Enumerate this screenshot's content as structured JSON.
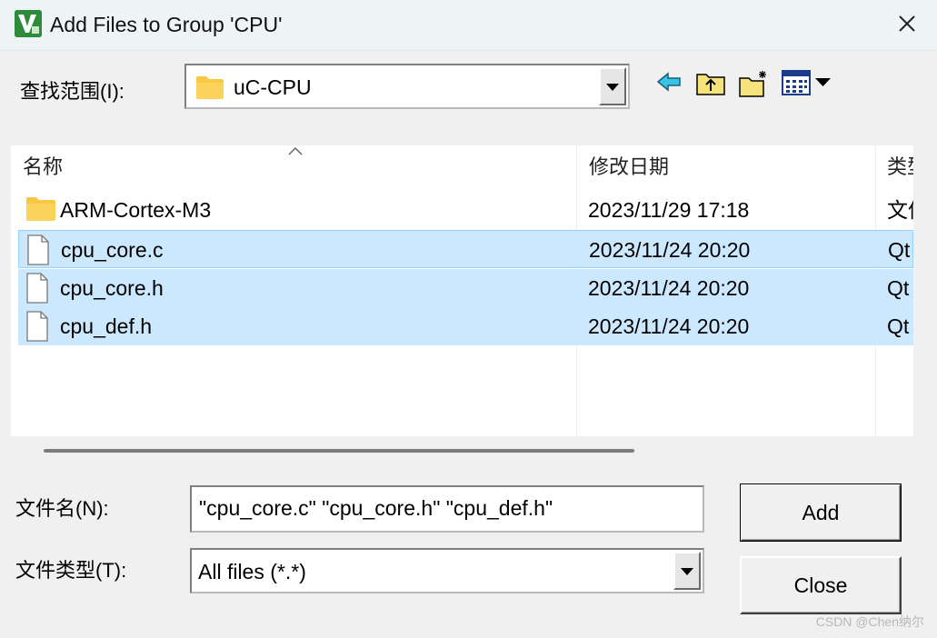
{
  "window": {
    "title": "Add Files to Group 'CPU'",
    "icon": "keil-uvision-icon",
    "close_icon": "close-icon"
  },
  "lookin": {
    "label": "查找范围(I):",
    "value": "uC-CPU",
    "icon": "folder-icon"
  },
  "toolbar": {
    "icons": [
      "back-arrow-icon",
      "up-folder-icon",
      "new-folder-icon",
      "view-menu-icon"
    ]
  },
  "list": {
    "columns": [
      "名称",
      "修改日期",
      "类型"
    ],
    "rows": [
      {
        "name": "ARM-Cortex-M3",
        "date": "2023/11/29 17:18",
        "type": "文件夹",
        "icon": "folder-icon",
        "selected": false
      },
      {
        "name": "cpu_core.c",
        "date": "2023/11/24 20:20",
        "type": "Qt",
        "icon": "file-icon",
        "selected": true
      },
      {
        "name": "cpu_core.h",
        "date": "2023/11/24 20:20",
        "type": "Qt",
        "icon": "file-icon",
        "selected": true
      },
      {
        "name": "cpu_def.h",
        "date": "2023/11/24 20:20",
        "type": "Qt",
        "icon": "file-icon",
        "selected": true
      }
    ]
  },
  "filename": {
    "label": "文件名(N):",
    "value": "\"cpu_core.c\" \"cpu_core.h\" \"cpu_def.h\""
  },
  "filetype": {
    "label": "文件类型(T):",
    "value": "All files (*.*)"
  },
  "buttons": {
    "add": "Add",
    "close": "Close"
  },
  "watermark": "CSDN @Chen纳尔",
  "colors": {
    "selection": "#cce8ff",
    "titlebar": "#eef3f6",
    "folder": "#f8c743"
  }
}
